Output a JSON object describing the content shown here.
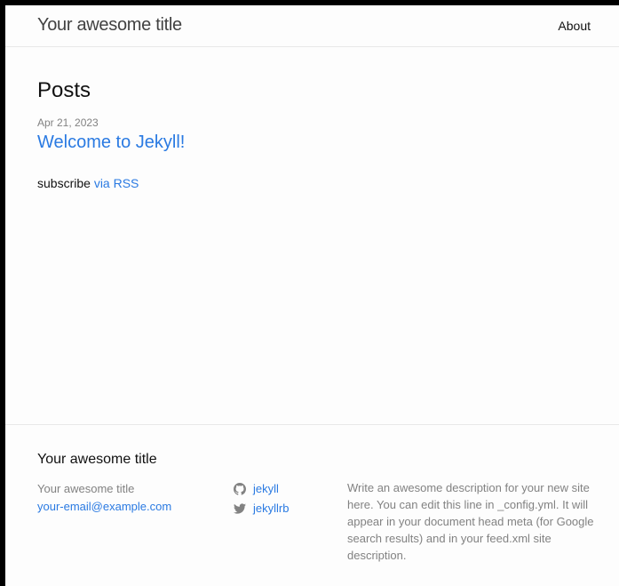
{
  "header": {
    "site_title": "Your awesome title",
    "nav": [
      {
        "label": "About"
      }
    ]
  },
  "main": {
    "heading": "Posts",
    "posts": [
      {
        "date": "Apr 21, 2023",
        "title": "Welcome to Jekyll!"
      }
    ],
    "rss": {
      "prefix": "subscribe",
      "link_label": "via RSS"
    }
  },
  "footer": {
    "heading": "Your awesome title",
    "name": "Your awesome title",
    "email": "your-email@example.com",
    "social": [
      {
        "icon": "github-icon",
        "label": "jekyll"
      },
      {
        "icon": "twitter-icon",
        "label": "jekyllrb"
      }
    ],
    "description": "Write an awesome description for your new site here. You can edit this line in _config.yml. It will appear in your document head meta (for Google search results) and in your feed.xml site description."
  },
  "colors": {
    "link": "#2a7ae2",
    "muted": "#828282",
    "border": "#e8e8e8",
    "background": "#fdfdfd"
  }
}
